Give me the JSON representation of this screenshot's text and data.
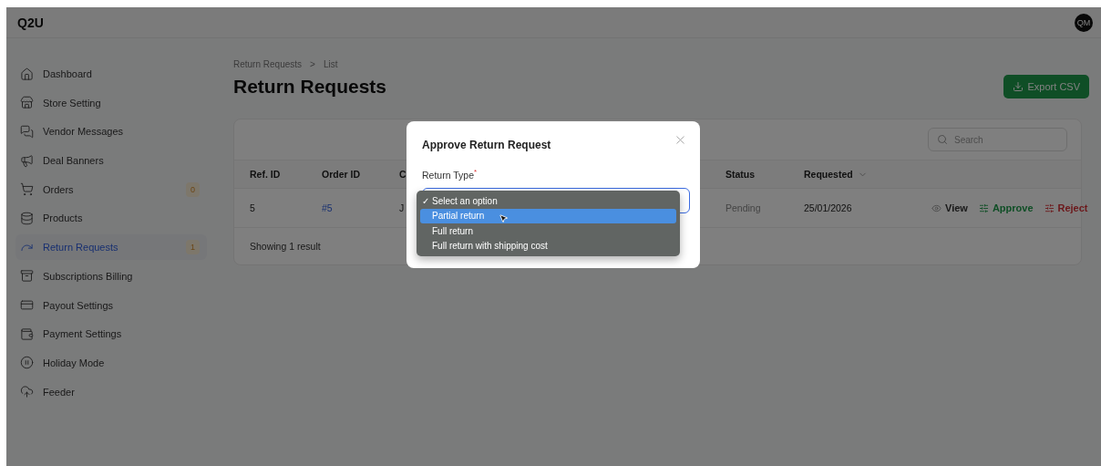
{
  "header": {
    "logo": "Q2U",
    "avatar": "QM"
  },
  "sidebar": {
    "items": [
      {
        "label": "Dashboard",
        "selected": false
      },
      {
        "label": "Store Setting",
        "selected": false
      },
      {
        "label": "Vendor Messages",
        "selected": false
      },
      {
        "label": "Deal Banners",
        "selected": false
      },
      {
        "label": "Orders",
        "selected": false,
        "badge": "0"
      },
      {
        "label": "Products",
        "selected": false
      },
      {
        "label": "Return Requests",
        "selected": true,
        "badge": "1"
      },
      {
        "label": "Subscriptions Billing",
        "selected": false
      },
      {
        "label": "Payout Settings",
        "selected": false
      },
      {
        "label": "Payment Settings",
        "selected": false
      },
      {
        "label": "Holiday Mode",
        "selected": false
      },
      {
        "label": "Feeder",
        "selected": false
      }
    ]
  },
  "breadcrumb": {
    "items": [
      "Return Requests",
      "List"
    ],
    "separator": ">"
  },
  "page_title": "Return Requests",
  "export_button": "Export CSV",
  "table": {
    "search": {
      "placeholder": "Search"
    },
    "columns": [
      {
        "label": "Ref. ID"
      },
      {
        "label": "Order ID"
      },
      {
        "label": "C"
      },
      {
        "label": "Status"
      },
      {
        "label": "Requested",
        "sortable": true
      }
    ],
    "rows": [
      {
        "cells": [
          {
            "text": "5",
            "kind": "plain"
          },
          {
            "text": "#5",
            "kind": "link"
          },
          {
            "text": "J",
            "kind": "plain"
          },
          {
            "text": "Pending",
            "kind": "muted"
          },
          {
            "text": "25/01/2026",
            "kind": "plain"
          }
        ],
        "actions": [
          {
            "label": "View",
            "kind": "view"
          },
          {
            "label": "Approve",
            "kind": "approve"
          },
          {
            "label": "Reject",
            "kind": "reject"
          }
        ]
      }
    ],
    "footer": "Showing 1 result"
  },
  "modal": {
    "title": "Approve Return Request",
    "field": {
      "label": "Return Type",
      "required": true,
      "required_mark": "*",
      "check_mark": "✓",
      "options": [
        {
          "label": "Select an option",
          "checked": true,
          "selected": false
        },
        {
          "label": "Partial return",
          "checked": false,
          "selected": true
        },
        {
          "label": "Full return",
          "checked": false,
          "selected": false
        },
        {
          "label": "Full return with shipping cost",
          "checked": false,
          "selected": false
        }
      ]
    }
  }
}
